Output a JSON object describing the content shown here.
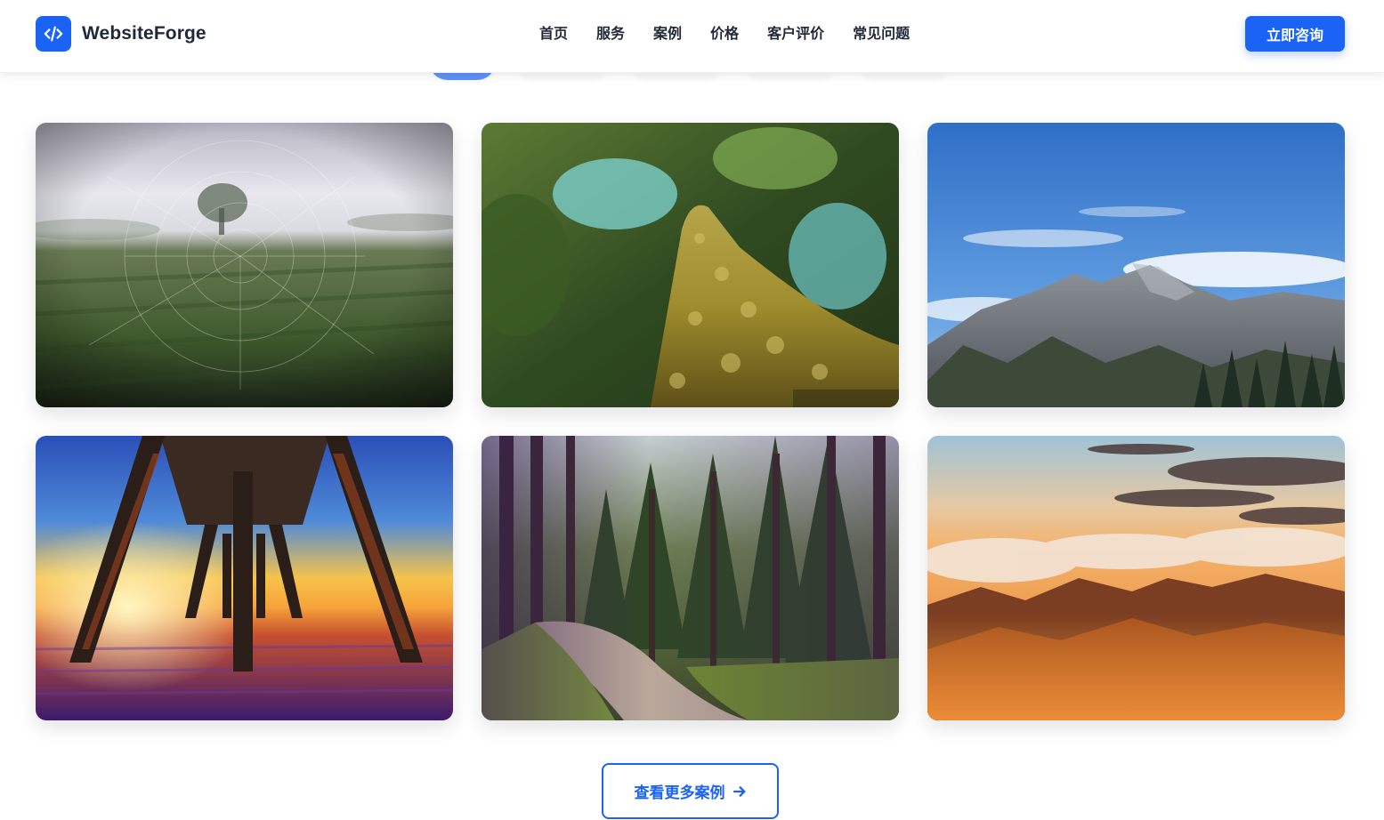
{
  "brand": {
    "name": "WebsiteForge",
    "logo_icon": "code-icon"
  },
  "nav": {
    "items": [
      {
        "label": "首页"
      },
      {
        "label": "服务"
      },
      {
        "label": "案例"
      },
      {
        "label": "价格"
      },
      {
        "label": "客户评价"
      },
      {
        "label": "常见问题"
      }
    ]
  },
  "header": {
    "cta_label": "立即咨询"
  },
  "colors": {
    "accent": "#1a63f5",
    "text": "#1f2937",
    "background": "#ffffff"
  },
  "gallery": {
    "items": [
      {
        "scene": "misty-field-spiderweb"
      },
      {
        "scene": "mossy-tree-trunk"
      },
      {
        "scene": "rocky-mountain-blue-sky"
      },
      {
        "scene": "pier-sunset"
      },
      {
        "scene": "forest-path"
      },
      {
        "scene": "mountains-sunset-clouds"
      }
    ]
  },
  "more_button": {
    "label": "查看更多案例",
    "icon": "arrow-right-icon"
  }
}
